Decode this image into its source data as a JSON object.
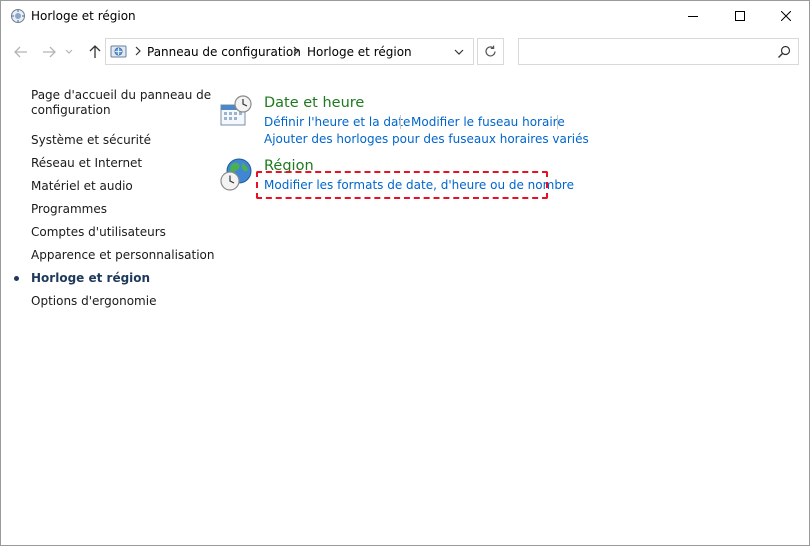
{
  "window": {
    "title": "Horloge et région",
    "controls": {
      "minimize_icon": "minimize-icon",
      "maximize_icon": "maximize-icon",
      "close_icon": "close-icon"
    }
  },
  "address": {
    "crumbs": [
      "Panneau de configuration",
      "Horloge et région"
    ],
    "search_placeholder": ""
  },
  "sidebar": {
    "home_label": "Page d'accueil du panneau de configuration",
    "home_line1": "Page d'accueil du panneau de",
    "home_line2": "configuration",
    "items": [
      {
        "label": "Système et sécurité",
        "current": false
      },
      {
        "label": "Réseau et Internet",
        "current": false
      },
      {
        "label": "Matériel et audio",
        "current": false
      },
      {
        "label": "Programmes",
        "current": false
      },
      {
        "label": "Comptes d'utilisateurs",
        "current": false
      },
      {
        "label": "Apparence et personnalisation",
        "current": false
      },
      {
        "label": "Horloge et région",
        "current": true
      },
      {
        "label": "Options d'ergonomie",
        "current": false
      }
    ]
  },
  "categories": [
    {
      "title": "Date et heure",
      "icon": "clock-calendar-icon",
      "links": [
        "Définir l'heure et la date",
        "Modifier le fuseau horaire",
        "Ajouter des horloges pour des fuseaux horaires variés"
      ]
    },
    {
      "title": "Région",
      "icon": "globe-clock-icon",
      "links": [
        "Modifier les formats de date, d'heure ou de nombre"
      ]
    }
  ],
  "colors": {
    "category_title": "#1e7a1e",
    "link": "#0066cc",
    "highlight_border": "#e81123",
    "current_nav": "#1e395b"
  }
}
